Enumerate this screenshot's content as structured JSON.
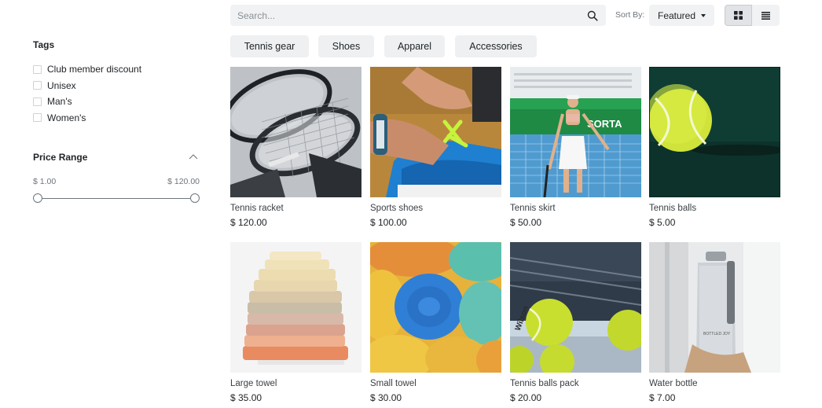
{
  "search": {
    "placeholder": "Search..."
  },
  "sort": {
    "label": "Sort By:",
    "selected": "Featured"
  },
  "view_modes": [
    "grid-view",
    "list-view"
  ],
  "categories": [
    {
      "label": "Tennis gear"
    },
    {
      "label": "Shoes"
    },
    {
      "label": "Apparel"
    },
    {
      "label": "Accessories"
    }
  ],
  "sidebar": {
    "tags_title": "Tags",
    "tags": [
      {
        "label": "Club member discount",
        "checked": false
      },
      {
        "label": "Unisex",
        "checked": false
      },
      {
        "label": "Man's",
        "checked": false
      },
      {
        "label": "Women's",
        "checked": false
      }
    ],
    "price_title": "Price Range",
    "price_min": "$ 1.00",
    "price_max": "$ 120.00"
  },
  "products": [
    {
      "name": "Tennis racket",
      "price": "$ 120.00"
    },
    {
      "name": "Sports shoes",
      "price": "$ 100.00"
    },
    {
      "name": "Tennis skirt",
      "price": "$ 50.00"
    },
    {
      "name": "Tennis balls",
      "price": "$ 5.00"
    },
    {
      "name": "Large towel",
      "price": "$ 35.00"
    },
    {
      "name": "Small towel",
      "price": "$ 30.00"
    },
    {
      "name": "Tennis balls pack",
      "price": "$ 20.00"
    },
    {
      "name": "Water bottle",
      "price": "$ 7.00"
    }
  ]
}
